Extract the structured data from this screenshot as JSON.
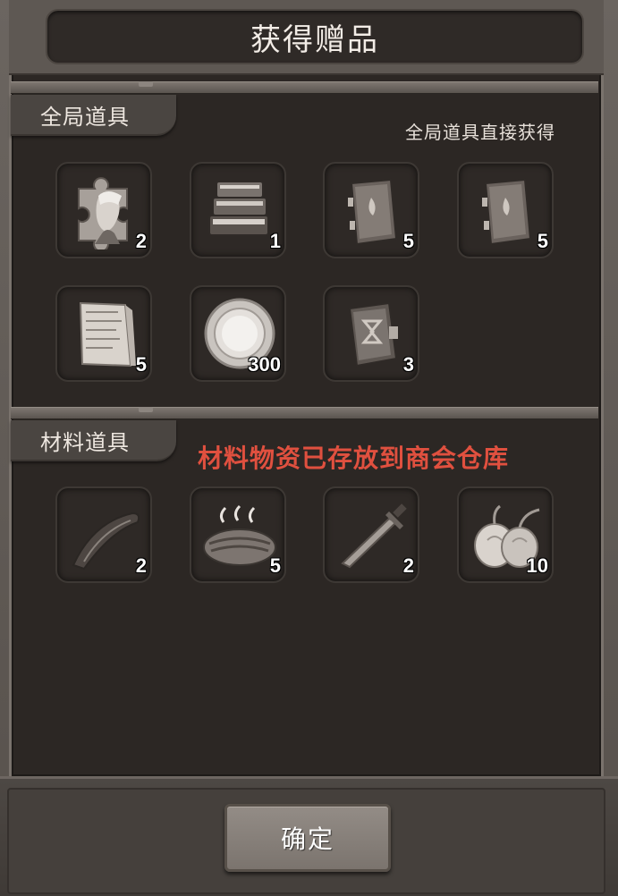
{
  "dialog": {
    "title": "获得赠品",
    "confirm_label": "确定"
  },
  "sections": [
    {
      "tab_label": "全局道具",
      "note": "全局道具直接获得",
      "items": [
        {
          "icon": "puzzle-portrait-icon",
          "qty": "2"
        },
        {
          "icon": "book-stack-icon",
          "qty": "1"
        },
        {
          "icon": "leather-tome-icon",
          "qty": "5"
        },
        {
          "icon": "leather-tome-icon",
          "qty": "5"
        },
        {
          "icon": "paper-scroll-icon",
          "qty": "5"
        },
        {
          "icon": "silver-coin-icon",
          "qty": "300"
        },
        {
          "icon": "clasped-book-icon",
          "qty": "3"
        }
      ]
    },
    {
      "tab_label": "材料道具",
      "note": "材料物资已存放到商会仓库",
      "note_color": "#e0503f",
      "items": [
        {
          "icon": "bow-icon",
          "qty": "2"
        },
        {
          "icon": "roasted-meat-icon",
          "qty": "5"
        },
        {
          "icon": "dagger-icon",
          "qty": "2"
        },
        {
          "icon": "onions-icon",
          "qty": "10"
        }
      ]
    }
  ]
}
